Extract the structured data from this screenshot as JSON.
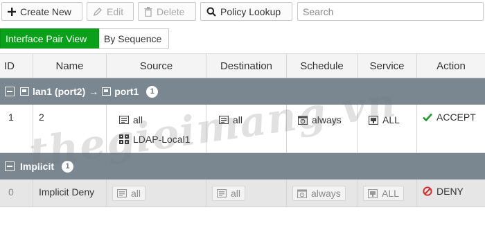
{
  "toolbar": {
    "create_label": "Create New",
    "edit_label": "Edit",
    "delete_label": "Delete",
    "lookup_label": "Policy Lookup",
    "search_placeholder": "Search"
  },
  "views": {
    "active": "Interface Pair View",
    "inactive": "By Sequence"
  },
  "columns": [
    "ID",
    "Name",
    "Source",
    "Destination",
    "Schedule",
    "Service",
    "Action"
  ],
  "groups": [
    {
      "from_label": "lan1 (port2)",
      "arrow": "→",
      "to_label": "port1",
      "count": "1",
      "policy": {
        "id": "1",
        "name": "2",
        "sources": [
          "all",
          "LDAP-Local1"
        ],
        "destination": "all",
        "schedule": "always",
        "service": "ALL",
        "action": "ACCEPT"
      }
    },
    {
      "label": "Implicit",
      "count": "1",
      "policy": {
        "id": "0",
        "name": "Implicit Deny",
        "source": "all",
        "destination": "all",
        "schedule": "always",
        "service": "ALL",
        "action": "DENY"
      }
    }
  ],
  "watermark": "thegioimang.vn",
  "colors": {
    "active_view": "#0aa01a",
    "group_bar": "#7a8791",
    "accept": "#1a9a2a",
    "deny": "#d32f2f"
  }
}
